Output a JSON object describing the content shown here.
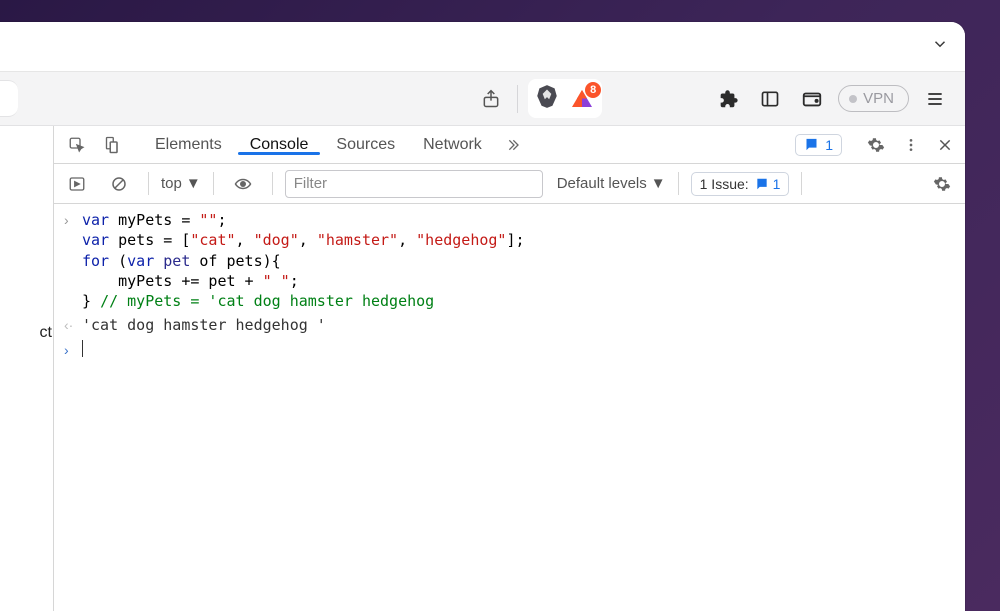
{
  "toolbar": {
    "badge_count": "8",
    "vpn_label": "VPN"
  },
  "devtools": {
    "tabs": {
      "elements": "Elements",
      "console": "Console",
      "sources": "Sources",
      "network": "Network"
    },
    "errors_count": "1",
    "sub": {
      "context": "top",
      "filter_placeholder": "Filter",
      "levels": "Default levels",
      "issues_label": "1 Issue:",
      "issues_count": "1"
    }
  },
  "left_stub": "ct",
  "console": {
    "input_lines": [
      {
        "segments": [
          {
            "t": "var",
            "c": "kw"
          },
          {
            "t": " myPets = ",
            "c": ""
          },
          {
            "t": "\"\"",
            "c": "str"
          },
          {
            "t": ";",
            "c": ""
          }
        ]
      },
      {
        "segments": [
          {
            "t": "var",
            "c": "kw"
          },
          {
            "t": " pets = [",
            "c": ""
          },
          {
            "t": "\"cat\"",
            "c": "str"
          },
          {
            "t": ", ",
            "c": ""
          },
          {
            "t": "\"dog\"",
            "c": "str"
          },
          {
            "t": ", ",
            "c": ""
          },
          {
            "t": "\"hamster\"",
            "c": "str"
          },
          {
            "t": ", ",
            "c": ""
          },
          {
            "t": "\"hedgehog\"",
            "c": "str"
          },
          {
            "t": "];",
            "c": ""
          }
        ]
      },
      {
        "segments": [
          {
            "t": "for",
            "c": "kw"
          },
          {
            "t": " (",
            "c": ""
          },
          {
            "t": "var",
            "c": "kw"
          },
          {
            "t": " ",
            "c": ""
          },
          {
            "t": "pet",
            "c": "ident"
          },
          {
            "t": " of ",
            "c": ""
          },
          {
            "t": "pets",
            "c": ""
          },
          {
            "t": "){",
            "c": ""
          }
        ]
      },
      {
        "segments": [
          {
            "t": "    myPets += pet + ",
            "c": ""
          },
          {
            "t": "\" \"",
            "c": "str"
          },
          {
            "t": ";",
            "c": ""
          }
        ]
      },
      {
        "segments": [
          {
            "t": "} ",
            "c": ""
          },
          {
            "t": "// myPets = 'cat dog hamster hedgehog",
            "c": "comm"
          }
        ]
      }
    ],
    "result": "'cat dog hamster hedgehog '"
  }
}
